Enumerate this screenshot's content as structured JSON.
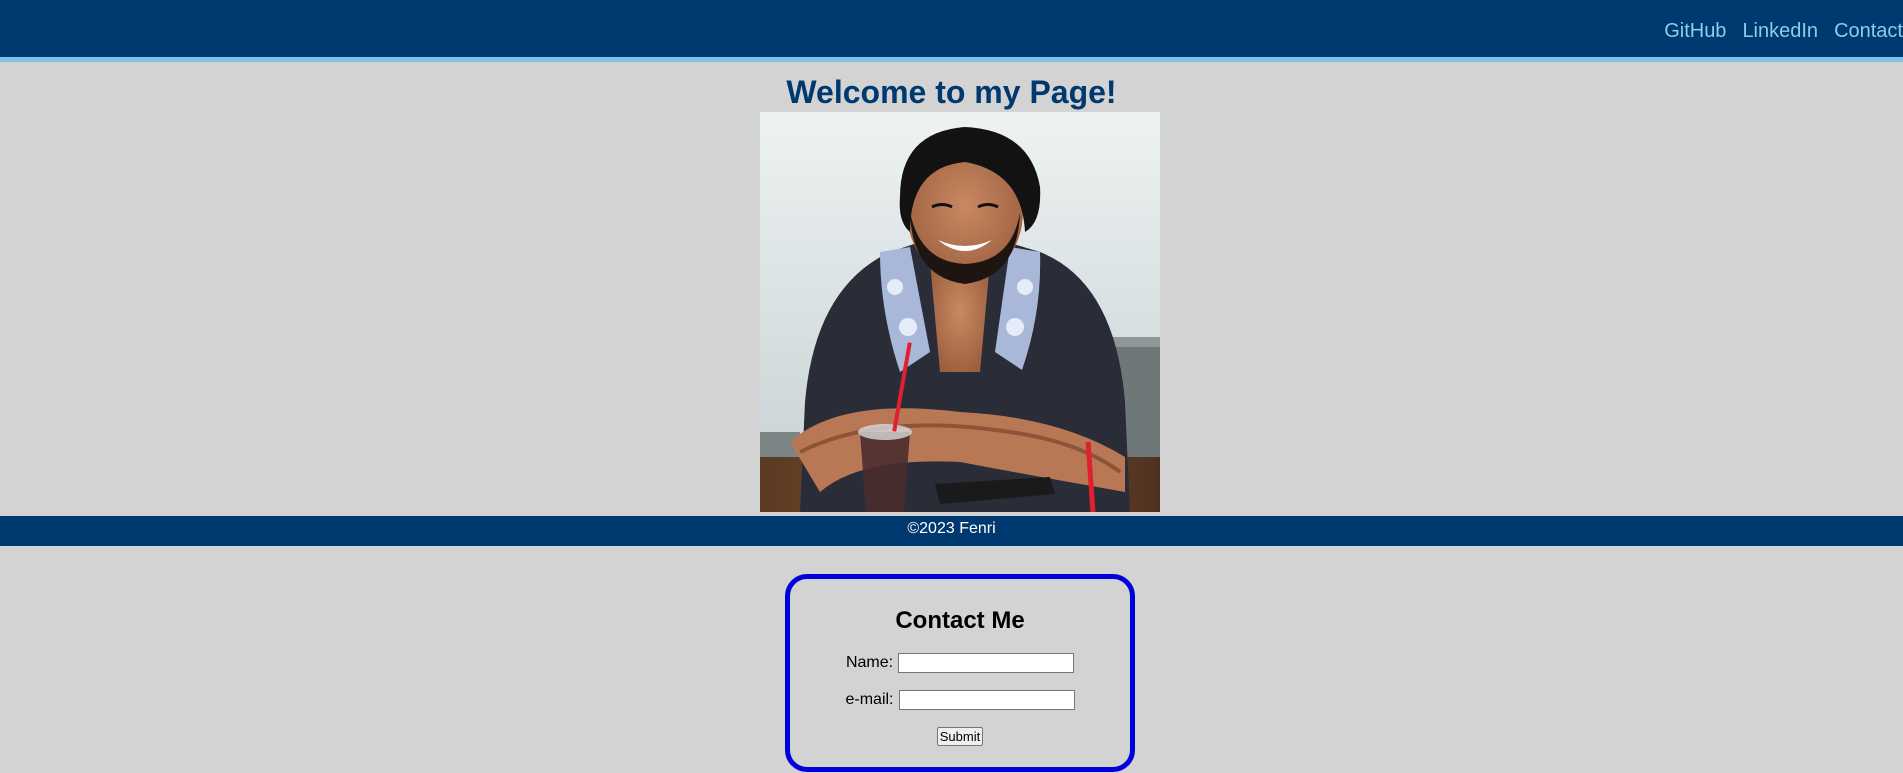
{
  "nav": {
    "links": [
      {
        "label": "GitHub"
      },
      {
        "label": "LinkedIn"
      },
      {
        "label": "Contact"
      }
    ]
  },
  "main": {
    "title": "Welcome to my Page!"
  },
  "footer": {
    "text": "©2023 Fenri"
  },
  "contact": {
    "heading": "Contact Me",
    "name_label": "Name:",
    "name_value": "",
    "email_label": "e-mail:",
    "email_value": "",
    "submit_label": "Submit"
  },
  "colors": {
    "header_bg": "#003870",
    "header_border": "#7ec3e8",
    "nav_link": "#87ceeb",
    "page_bg": "#d3d3d3",
    "contact_border": "#0000dd"
  }
}
